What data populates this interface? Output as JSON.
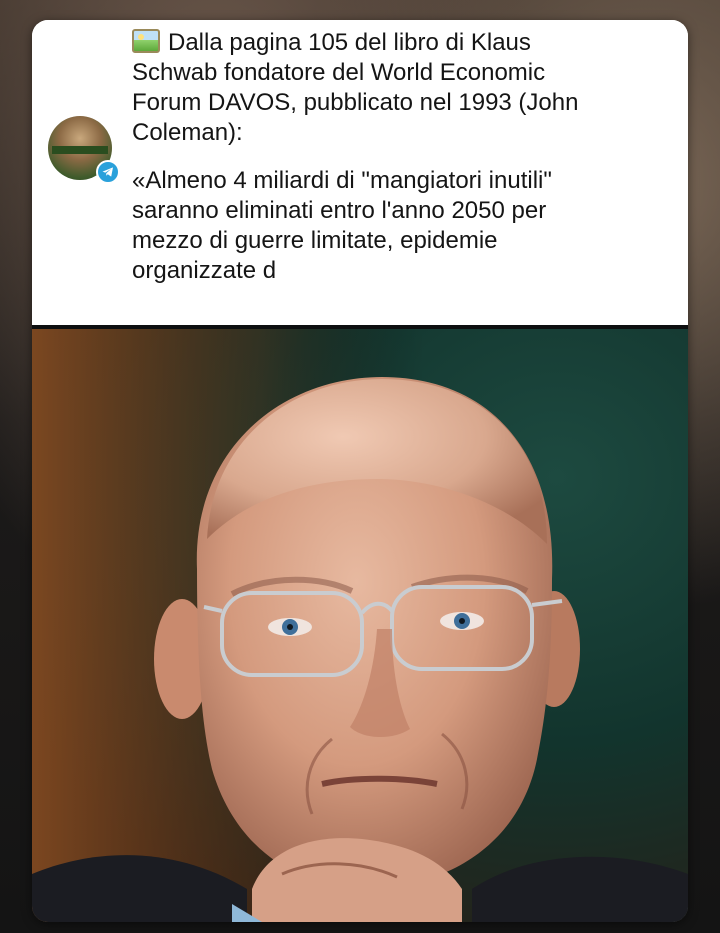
{
  "post": {
    "line1": "Dalla pagina 105 del libro di Klaus",
    "line2": "Schwab fondatore del World Economic",
    "line3": "Forum DAVOS, pubblicato nel 1993 (John",
    "line4": "Coleman):",
    "quote1": "«Almeno 4 miliardi di \"mangiatori inutili\"",
    "quote2": "saranno eliminati entro l'anno 2050 per",
    "quote3": "mezzo di guerre limitate, epidemie",
    "quote4": "organizzate d",
    "leading_icon": "framed-picture-icon"
  },
  "channel": {
    "avatar_icon": "channel-avatar",
    "badge_icon": "telegram-icon",
    "badge_color": "#2aa1db"
  },
  "photo": {
    "subject": "portrait-photo",
    "background_color": "#12342d"
  }
}
